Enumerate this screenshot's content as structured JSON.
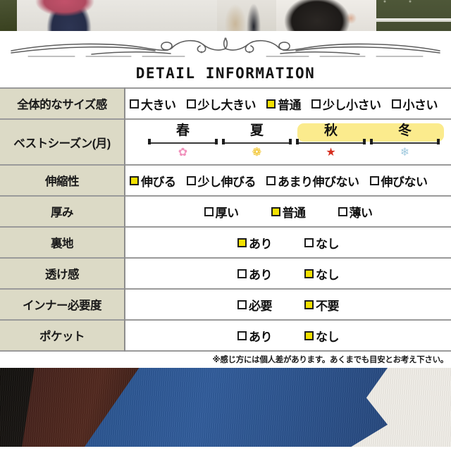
{
  "header": {
    "title": "DETAIL INFORMATION",
    "ornament_name": "decorative-flourish"
  },
  "photo_strip": {
    "cells": [
      {
        "name": "photo-thumb-1"
      },
      {
        "name": "photo-thumb-2"
      },
      {
        "name": "photo-thumb-3"
      },
      {
        "name": "photo-thumb-4"
      },
      {
        "name": "green-panel"
      }
    ]
  },
  "colors": {
    "label_bg": "#dcdac6",
    "checked_box": "#f2e000",
    "highlight": "#fbeb8d",
    "border": "#8d8d8d",
    "text": "#111111"
  },
  "rows": {
    "size": {
      "label": "全体的なサイズ感",
      "options": [
        {
          "label": "大きい",
          "checked": false
        },
        {
          "label": "少し大きい",
          "checked": false
        },
        {
          "label": "普通",
          "checked": true
        },
        {
          "label": "少し小さい",
          "checked": false
        },
        {
          "label": "小さい",
          "checked": false
        }
      ]
    },
    "season": {
      "label": "ベストシーズン(月)",
      "items": [
        {
          "kanji": "春",
          "icon": "cherry-blossom-icon",
          "glyph": "✿",
          "color": "#f193bd",
          "highlighted": false
        },
        {
          "kanji": "夏",
          "icon": "sunflower-icon",
          "glyph": "❁",
          "color": "#f4c824",
          "highlighted": false
        },
        {
          "kanji": "秋",
          "icon": "maple-leaf-icon",
          "glyph": "🍁",
          "color": "#d62f20",
          "highlighted": true
        },
        {
          "kanji": "冬",
          "icon": "snowflake-icon",
          "glyph": "❄",
          "color": "#a8cfe0",
          "highlighted": true
        }
      ]
    },
    "stretch": {
      "label": "伸縮性",
      "options": [
        {
          "label": "伸びる",
          "checked": true
        },
        {
          "label": "少し伸びる",
          "checked": false
        },
        {
          "label": "あまり伸びない",
          "checked": false
        },
        {
          "label": "伸びない",
          "checked": false
        }
      ]
    },
    "thickness": {
      "label": "厚み",
      "options": [
        {
          "label": "厚い",
          "checked": false
        },
        {
          "label": "普通",
          "checked": true
        },
        {
          "label": "薄い",
          "checked": false
        }
      ]
    },
    "lining": {
      "label": "裏地",
      "options": [
        {
          "label": "あり",
          "checked": true
        },
        {
          "label": "なし",
          "checked": false
        }
      ]
    },
    "sheerness": {
      "label": "透け感",
      "options": [
        {
          "label": "あり",
          "checked": false
        },
        {
          "label": "なし",
          "checked": true
        }
      ]
    },
    "inner": {
      "label": "インナー必要度",
      "options": [
        {
          "label": "必要",
          "checked": false
        },
        {
          "label": "不要",
          "checked": true
        }
      ]
    },
    "pocket": {
      "label": "ポケット",
      "options": [
        {
          "label": "あり",
          "checked": false
        },
        {
          "label": "なし",
          "checked": true
        }
      ]
    }
  },
  "note": "※感じ方には個人差があります。あくまでも目安とお考え下さい。"
}
